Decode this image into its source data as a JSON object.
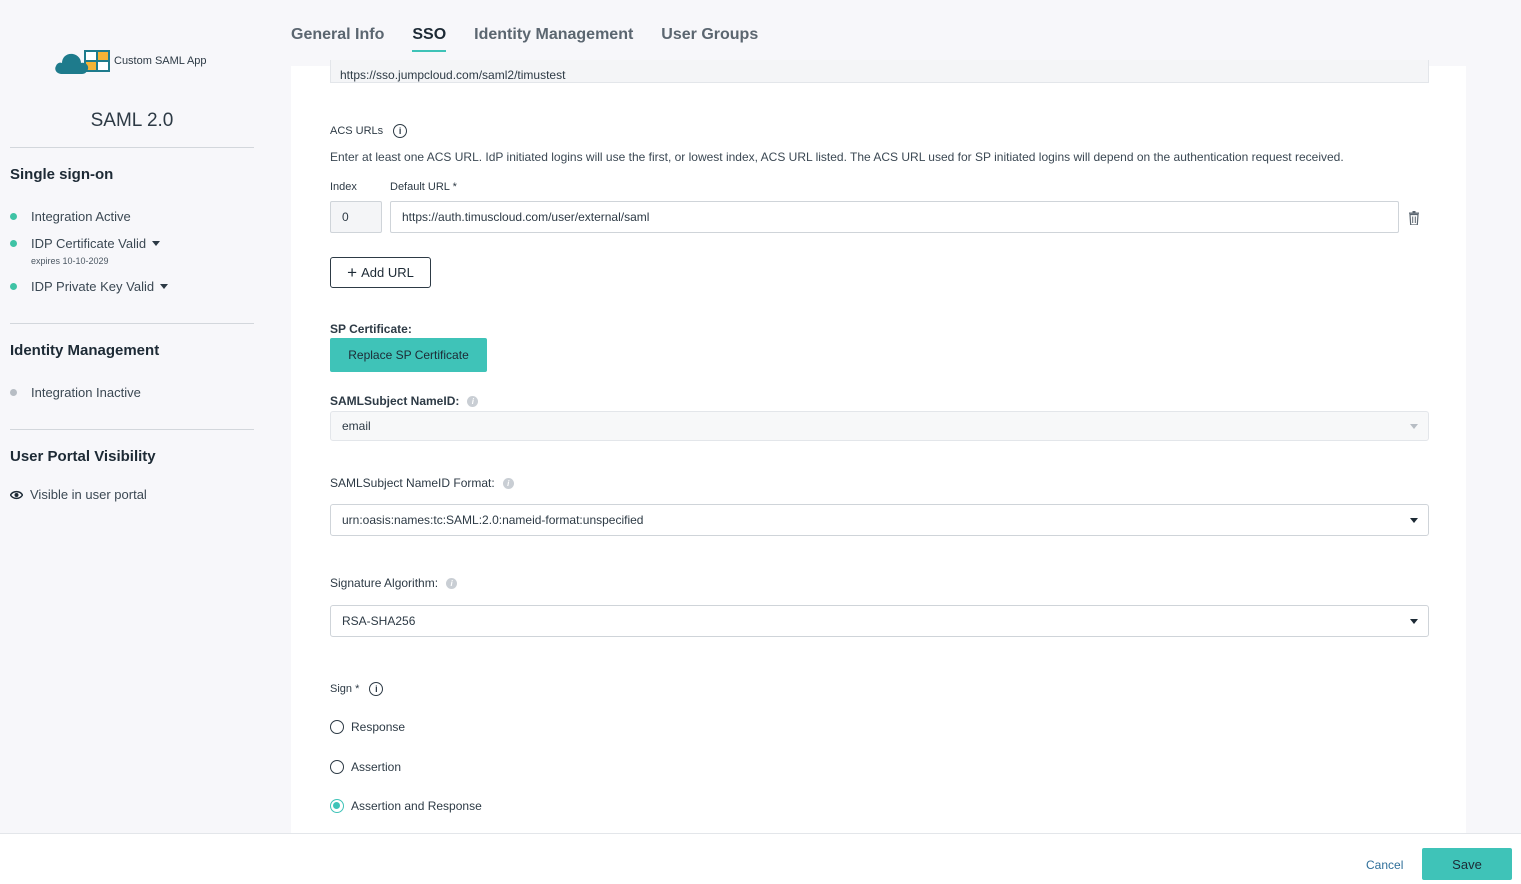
{
  "app": {
    "logo_text": "Custom SAML App",
    "protocol_title": "SAML 2.0"
  },
  "sidebar": {
    "sso": {
      "title": "Single sign-on",
      "items": [
        {
          "label": "Integration Active",
          "status": "active"
        },
        {
          "label": "IDP Certificate Valid",
          "sub": "expires 10-10-2029",
          "status": "active"
        },
        {
          "label": "IDP Private Key Valid",
          "status": "active"
        }
      ]
    },
    "identity": {
      "title": "Identity Management",
      "items": [
        {
          "label": "Integration Inactive",
          "status": "inactive"
        }
      ]
    },
    "portal": {
      "title": "User Portal Visibility",
      "item": "Visible in user portal"
    }
  },
  "tabs": [
    {
      "label": "General Info"
    },
    {
      "label": "SSO",
      "active": true
    },
    {
      "label": "Identity Management"
    },
    {
      "label": "User Groups"
    }
  ],
  "form": {
    "top_url": "https://sso.jumpcloud.com/saml2/timustest",
    "acs": {
      "label": "ACS URLs",
      "help": "Enter at least one ACS URL. IdP initiated logins will use the first, or lowest index, ACS URL listed. The ACS URL used for SP initiated logins will depend on the authentication request received.",
      "index_label": "Index",
      "default_url_label": "Default URL *",
      "index_value": "0",
      "url_value": "https://auth.timuscloud.com/user/external/saml",
      "add_button": "Add URL"
    },
    "sp_cert": {
      "label": "SP Certificate:",
      "button": "Replace SP Certificate"
    },
    "nameid": {
      "label": "SAMLSubject NameID:",
      "value": "email"
    },
    "nameid_format": {
      "label": "SAMLSubject NameID Format:",
      "value": "urn:oasis:names:tc:SAML:2.0:nameid-format:unspecified"
    },
    "sig_alg": {
      "label": "Signature Algorithm:",
      "value": "RSA-SHA256"
    },
    "sign": {
      "label": "Sign *",
      "options": [
        {
          "label": "Response",
          "checked": false
        },
        {
          "label": "Assertion",
          "checked": false
        },
        {
          "label": "Assertion and Response",
          "checked": true
        }
      ]
    }
  },
  "footer": {
    "cancel": "Cancel",
    "save": "Save"
  },
  "colors": {
    "accent": "#3fc3b8",
    "active_dot": "#3fc3a5",
    "inactive_dot": "#b7bdc4",
    "link": "#2f6f9a"
  },
  "icons": {
    "info": "info-icon",
    "trash": "trash-icon",
    "eye": "eye-icon",
    "plus": "plus-icon"
  }
}
